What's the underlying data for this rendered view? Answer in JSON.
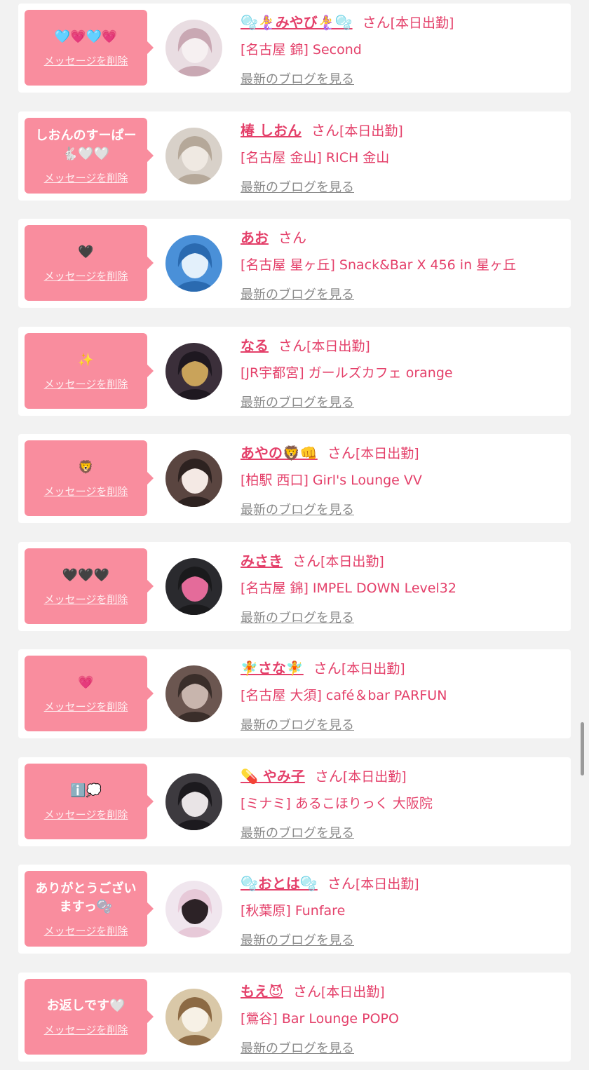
{
  "delete_label": "メッセージを削除",
  "blog_label": "最新のブログを見る",
  "honorific": "さん",
  "colors": {
    "page_background": "#f2f2f2",
    "card_background": "#ffffff",
    "bubble": "#f98d9e",
    "name": "#e4406a",
    "link_gray": "#8a8a8a"
  },
  "entries": [
    {
      "message": "🩵💗🩵💗",
      "name": "🫧🧜‍♀️みやび🧜‍♀️🫧",
      "attendance": "[本日出勤]",
      "shop": "[名古屋 錦] Second",
      "avatar_colors": [
        "#e9dde2",
        "#f6f0f1",
        "#c9a8b3"
      ]
    },
    {
      "message": "しおんのすーぱー\n🐇🤍🤍",
      "name": "椿 しおん",
      "attendance": "[本日出勤]",
      "shop": "[名古屋 金山] RICH 金山",
      "avatar_colors": [
        "#d8d1c9",
        "#efe9e2",
        "#b5a899"
      ]
    },
    {
      "message": "🖤",
      "name": "あお",
      "attendance": "",
      "shop": "[名古屋 星ヶ丘] Snack&Bar X 456 in 星ヶ丘",
      "avatar_colors": [
        "#4a90d8",
        "#e3f0fb",
        "#2a6ab0"
      ]
    },
    {
      "message": "✨",
      "name": "なる",
      "attendance": "[本日出勤]",
      "shop": "[JR宇都宮] ガールズカフェ orange",
      "avatar_colors": [
        "#3b2f3a",
        "#c9a35a",
        "#1e1820"
      ]
    },
    {
      "message": "🦁",
      "name": "あやの🦁👊",
      "attendance": "[本日出勤]",
      "shop": "[柏駅 西口] Girl's Lounge VV",
      "avatar_colors": [
        "#5a4540",
        "#f4e9e4",
        "#2d2220"
      ]
    },
    {
      "message": "🖤🖤🖤",
      "name": "みさき",
      "attendance": "[本日出勤]",
      "shop": "[名古屋 錦] IMPEL DOWN Level32",
      "avatar_colors": [
        "#2a2a2e",
        "#e46b9a",
        "#1a1a1c"
      ]
    },
    {
      "message": "💗",
      "name": "🧚さな🧚",
      "attendance": "[本日出勤]",
      "shop": "[名古屋 大須] café＆bar PARFUN",
      "avatar_colors": [
        "#6b5650",
        "#c8b5ad",
        "#3a2e2a"
      ]
    },
    {
      "message": "ℹ️💭",
      "name": "💊 やみ子",
      "attendance": "[本日出勤]",
      "shop": "[ミナミ] あるこほりっく 大阪院",
      "avatar_colors": [
        "#3d3a3f",
        "#e9e4e6",
        "#1c1a1e"
      ]
    },
    {
      "message": "ありがとうござい\nますっ🫧",
      "name": "🫧おとは🫧",
      "attendance": "[本日出勤]",
      "shop": "[秋葉原] Funfare",
      "avatar_colors": [
        "#f0e6ee",
        "#2c2226",
        "#e7c9d8"
      ]
    },
    {
      "message": "お返しです🤍",
      "name": "もえ😈",
      "attendance": "[本日出勤]",
      "shop": "[鶯谷] Bar Lounge POPO",
      "avatar_colors": [
        "#d9c8a8",
        "#f7f1e6",
        "#8c6a44"
      ]
    }
  ]
}
